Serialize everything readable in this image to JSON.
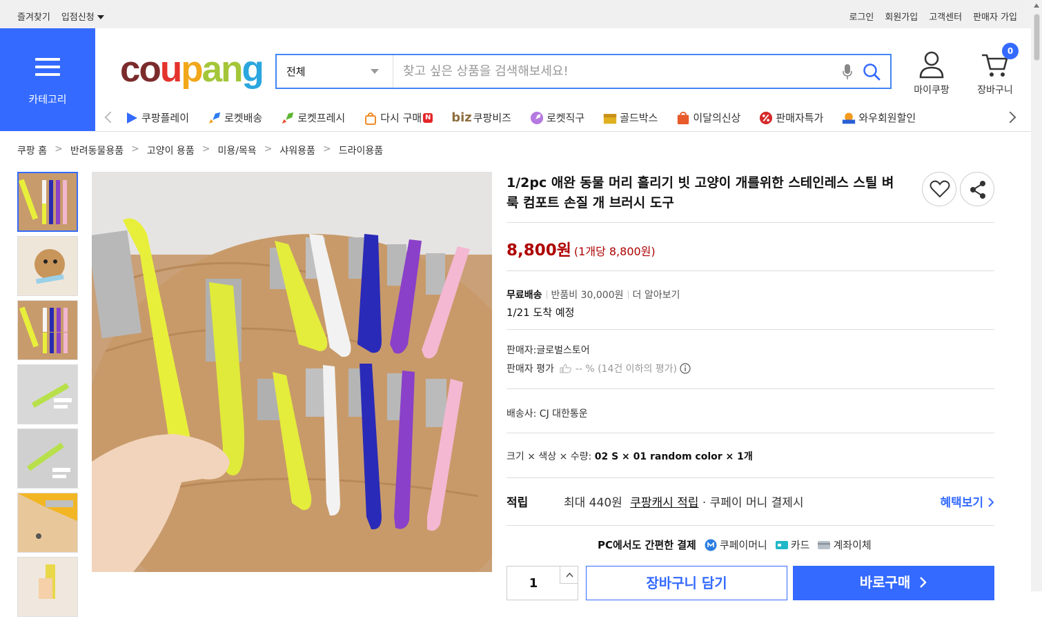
{
  "topbar": {
    "left": [
      "즐겨찾기",
      "입점신청"
    ],
    "right": [
      "로그인",
      "회원가입",
      "고객센터",
      "판매자 가입"
    ]
  },
  "category": {
    "label": "카테고리"
  },
  "logo": {
    "parts": [
      "co",
      "u",
      "p",
      "an",
      "g"
    ]
  },
  "search": {
    "scope": "전체",
    "placeholder": "찾고 싶은 상품을 검색해보세요!"
  },
  "header": {
    "mycoupang": "마이쿠팡",
    "cart": "장바구니",
    "cart_count": "0"
  },
  "nav": [
    {
      "label": "쿠팡플레이",
      "color": "#346aff"
    },
    {
      "label": "로켓배송",
      "color": "#2e7ef0"
    },
    {
      "label": "로켓프레시",
      "color": "#5cb531"
    },
    {
      "label": "다시 구매",
      "color": "#f08a24"
    },
    {
      "label": "쿠팡비즈",
      "color": "#8c6d3f"
    },
    {
      "label": "로켓직구",
      "color": "#9b59d0"
    },
    {
      "label": "골드박스",
      "color": "#e0b020"
    },
    {
      "label": "이달의신상",
      "color": "#e85a2a"
    },
    {
      "label": "판매자특가",
      "color": "#d52a2a"
    },
    {
      "label": "와우회원할인",
      "color": "#e8621f"
    }
  ],
  "nav_extra": {
    "biz": "biz",
    "new_badge": "N"
  },
  "breadcrumb": [
    "쿠팡 홈",
    "반려동물용품",
    "고양이 용품",
    "미용/목욕",
    "샤워용품",
    "드라이용품"
  ],
  "product": {
    "title": "1/2pc 애완 동물 머리 흘리기 빗 고양이 개를위한 스테인레스 스틸 벼룩 컴포트 손질 개 브러시 도구",
    "price": "8,800원",
    "unit_price": "(1개당 8,800원)",
    "shipping": "무료배송",
    "return_fee": "반품비 30,000원",
    "learn_more": "더 알아보기",
    "arrival": "1/21 도착 예정",
    "seller": "판매자:글로벌스토어",
    "rating_label": "판매자 평가",
    "rating_value": "-- %",
    "rating_note": "(14건 이하의 평가)",
    "carrier": "배송사:  CJ 대한통운",
    "option_label": "크기 × 색상 × 수량: ",
    "option_value": "02 S × 01 random color × 1개",
    "reward_title": "적립",
    "reward_amount": "최대 440원",
    "reward_link": "쿠팡캐시 적립",
    "reward_tail": " · 쿠페이 머니 결제시",
    "benefit": "혜택보기",
    "pay_title": "PC에서도 간편한 결제",
    "pay_methods": [
      "쿠페이머니",
      "카드",
      "계좌이체"
    ],
    "qty": "1",
    "cart_btn": "장바구니 담기",
    "buy_btn": "바로구매"
  },
  "colors": {
    "accent": "#346aff",
    "price": "#ae0000"
  }
}
